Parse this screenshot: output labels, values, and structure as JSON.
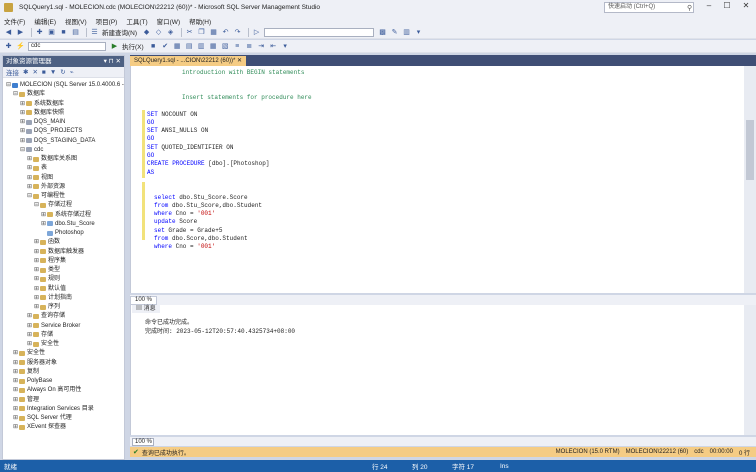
{
  "window": {
    "title": "SQLQuery1.sql - MOLECION.cdc (MOLECION\\22212 (60))* - Microsoft SQL Server Management Studio",
    "quick_launch_placeholder": "快速启动 (Ctrl+Q)"
  },
  "menu": [
    "文件(F)",
    "编辑(E)",
    "视图(V)",
    "项目(P)",
    "工具(T)",
    "窗口(W)",
    "帮助(H)"
  ],
  "toolbar1": {
    "new_query": "新建查询(N)",
    "search_combo": ""
  },
  "toolbar2": {
    "db_combo": "cdc",
    "execute": "执行(X)"
  },
  "object_explorer": {
    "title": "对象资源管理器",
    "connect": "连接",
    "tree": [
      {
        "level": 0,
        "exp": "⊟",
        "icon": "srv",
        "label": "MOLECION (SQL Server 15.0.4000.6 - MOLECION\\22212)"
      },
      {
        "level": 1,
        "exp": "⊟",
        "icon": "folder",
        "label": "数据库"
      },
      {
        "level": 2,
        "exp": "⊞",
        "icon": "folder",
        "label": "系统数据库"
      },
      {
        "level": 2,
        "exp": "⊞",
        "icon": "folder",
        "label": "数据库快照"
      },
      {
        "level": 2,
        "exp": "⊞",
        "icon": "db",
        "label": "DQS_MAIN"
      },
      {
        "level": 2,
        "exp": "⊞",
        "icon": "db",
        "label": "DQS_PROJECTS"
      },
      {
        "level": 2,
        "exp": "⊞",
        "icon": "db",
        "label": "DQS_STAGING_DATA"
      },
      {
        "level": 2,
        "exp": "⊟",
        "icon": "db",
        "label": "cdc"
      },
      {
        "level": 3,
        "exp": "⊞",
        "icon": "folder",
        "label": "数据库关系图"
      },
      {
        "level": 3,
        "exp": "⊞",
        "icon": "folder",
        "label": "表"
      },
      {
        "level": 3,
        "exp": "⊞",
        "icon": "folder",
        "label": "视图"
      },
      {
        "level": 3,
        "exp": "⊞",
        "icon": "folder",
        "label": "外部资源"
      },
      {
        "level": 3,
        "exp": "⊟",
        "icon": "folder",
        "label": "可编程性"
      },
      {
        "level": 4,
        "exp": "⊟",
        "icon": "folder",
        "label": "存储过程"
      },
      {
        "level": 5,
        "exp": "⊞",
        "icon": "folder",
        "label": "系统存储过程"
      },
      {
        "level": 5,
        "exp": "⊞",
        "icon": "tbl",
        "label": "dbo.Stu_Score"
      },
      {
        "level": 5,
        "exp": "",
        "icon": "tbl",
        "label": "Photoshop"
      },
      {
        "level": 4,
        "exp": "⊞",
        "icon": "folder",
        "label": "函数"
      },
      {
        "level": 4,
        "exp": "⊞",
        "icon": "folder",
        "label": "数据库触发器"
      },
      {
        "level": 4,
        "exp": "⊞",
        "icon": "folder",
        "label": "程序集"
      },
      {
        "level": 4,
        "exp": "⊞",
        "icon": "folder",
        "label": "类型"
      },
      {
        "level": 4,
        "exp": "⊞",
        "icon": "folder",
        "label": "规则"
      },
      {
        "level": 4,
        "exp": "⊞",
        "icon": "folder",
        "label": "默认值"
      },
      {
        "level": 4,
        "exp": "⊞",
        "icon": "folder",
        "label": "计划指南"
      },
      {
        "level": 4,
        "exp": "⊞",
        "icon": "folder",
        "label": "序列"
      },
      {
        "level": 3,
        "exp": "⊞",
        "icon": "folder",
        "label": "查询存储"
      },
      {
        "level": 3,
        "exp": "⊞",
        "icon": "folder",
        "label": "Service Broker"
      },
      {
        "level": 3,
        "exp": "⊞",
        "icon": "folder",
        "label": "存储"
      },
      {
        "level": 3,
        "exp": "⊞",
        "icon": "folder",
        "label": "安全性"
      },
      {
        "level": 1,
        "exp": "⊞",
        "icon": "folder",
        "label": "安全性"
      },
      {
        "level": 1,
        "exp": "⊞",
        "icon": "folder",
        "label": "服务器对象"
      },
      {
        "level": 1,
        "exp": "⊞",
        "icon": "folder",
        "label": "复制"
      },
      {
        "level": 1,
        "exp": "⊞",
        "icon": "folder",
        "label": "PolyBase"
      },
      {
        "level": 1,
        "exp": "⊞",
        "icon": "folder",
        "label": "Always On 高可用性"
      },
      {
        "level": 1,
        "exp": "⊞",
        "icon": "folder",
        "label": "管理"
      },
      {
        "level": 1,
        "exp": "⊞",
        "icon": "folder",
        "label": "Integration Services 目录"
      },
      {
        "level": 1,
        "exp": "⊞",
        "icon": "folder",
        "label": "SQL Server 代理"
      },
      {
        "level": 1,
        "exp": "⊞",
        "icon": "folder",
        "label": "XEvent 探查器"
      }
    ]
  },
  "tabs": [
    {
      "label": "SQLQuery1.sql - ...CION\\22212 (60))*",
      "active": true
    }
  ],
  "editor": {
    "lines": [
      {
        "indent": 5,
        "parts": [
          {
            "t": "introduction with BEGIN statements",
            "c": "cm"
          }
        ]
      },
      {
        "indent": 0,
        "parts": [
          {
            "t": "",
            "c": ""
          }
        ]
      },
      {
        "indent": 0,
        "parts": [
          {
            "t": "",
            "c": ""
          }
        ]
      },
      {
        "indent": 5,
        "parts": [
          {
            "t": "Insert statements for procedure here",
            "c": "cm"
          }
        ]
      },
      {
        "indent": 0,
        "parts": [
          {
            "t": "",
            "c": ""
          }
        ]
      },
      {
        "indent": 0,
        "parts": [
          {
            "t": "SET ",
            "c": "kw"
          },
          {
            "t": "NOCOUNT ON",
            "c": ""
          }
        ]
      },
      {
        "indent": 0,
        "parts": [
          {
            "t": "GO",
            "c": "kw"
          }
        ]
      },
      {
        "indent": 0,
        "parts": [
          {
            "t": "SET ",
            "c": "kw"
          },
          {
            "t": "ANSI_NULLS ON",
            "c": ""
          }
        ]
      },
      {
        "indent": 0,
        "parts": [
          {
            "t": "GO",
            "c": "kw"
          }
        ]
      },
      {
        "indent": 0,
        "parts": [
          {
            "t": "SET ",
            "c": "kw"
          },
          {
            "t": "QUOTED_IDENTIFIER ON",
            "c": ""
          }
        ]
      },
      {
        "indent": 0,
        "parts": [
          {
            "t": "GO",
            "c": "kw"
          }
        ]
      },
      {
        "indent": 0,
        "parts": [
          {
            "t": "CREATE PROCEDURE ",
            "c": "kw"
          },
          {
            "t": "[dbo].[Photoshop]",
            "c": ""
          }
        ]
      },
      {
        "indent": 0,
        "parts": [
          {
            "t": "AS",
            "c": "kw"
          }
        ]
      },
      {
        "indent": 0,
        "parts": [
          {
            "t": "",
            "c": ""
          }
        ]
      },
      {
        "indent": 0,
        "parts": [
          {
            "t": "",
            "c": ""
          }
        ]
      },
      {
        "indent": 1,
        "parts": [
          {
            "t": "select ",
            "c": "kw"
          },
          {
            "t": "dbo.Stu_Score.Score",
            "c": ""
          }
        ]
      },
      {
        "indent": 1,
        "parts": [
          {
            "t": "from ",
            "c": "kw"
          },
          {
            "t": "dbo.Stu_Score,dbo.Student",
            "c": ""
          }
        ]
      },
      {
        "indent": 1,
        "parts": [
          {
            "t": "where ",
            "c": "kw"
          },
          {
            "t": "Cno = ",
            "c": ""
          },
          {
            "t": "'001'",
            "c": "str"
          }
        ]
      },
      {
        "indent": 1,
        "parts": [
          {
            "t": "update ",
            "c": "kw"
          },
          {
            "t": "Score",
            "c": ""
          }
        ]
      },
      {
        "indent": 1,
        "parts": [
          {
            "t": "set ",
            "c": "kw"
          },
          {
            "t": "Grade = Grade+5",
            "c": ""
          }
        ]
      },
      {
        "indent": 1,
        "parts": [
          {
            "t": "from ",
            "c": "kw"
          },
          {
            "t": "dbo.Score,dbo.Student",
            "c": ""
          }
        ]
      },
      {
        "indent": 1,
        "parts": [
          {
            "t": "where ",
            "c": "kw"
          },
          {
            "t": "Cno = ",
            "c": ""
          },
          {
            "t": "'001'",
            "c": "str"
          }
        ]
      }
    ]
  },
  "results": {
    "zoom_editor": "100 %",
    "tab_label": "消息",
    "message_1": "命令已成功完成。",
    "message_2": "完成时间: 2023-05-12T20:57:40.4325734+08:00",
    "zoom_results": "100 %"
  },
  "querybar": {
    "status": "查询已成功执行。",
    "server": "MOLECION (15.0 RTM)",
    "user": "MOLECION\\22212 (60)",
    "db": "cdc",
    "time": "00:00:00",
    "rows": "0 行"
  },
  "statusbar": {
    "left": "就绪",
    "line": "行 24",
    "col": "列 20",
    "ch": "字符 17",
    "mode": "Ins"
  }
}
